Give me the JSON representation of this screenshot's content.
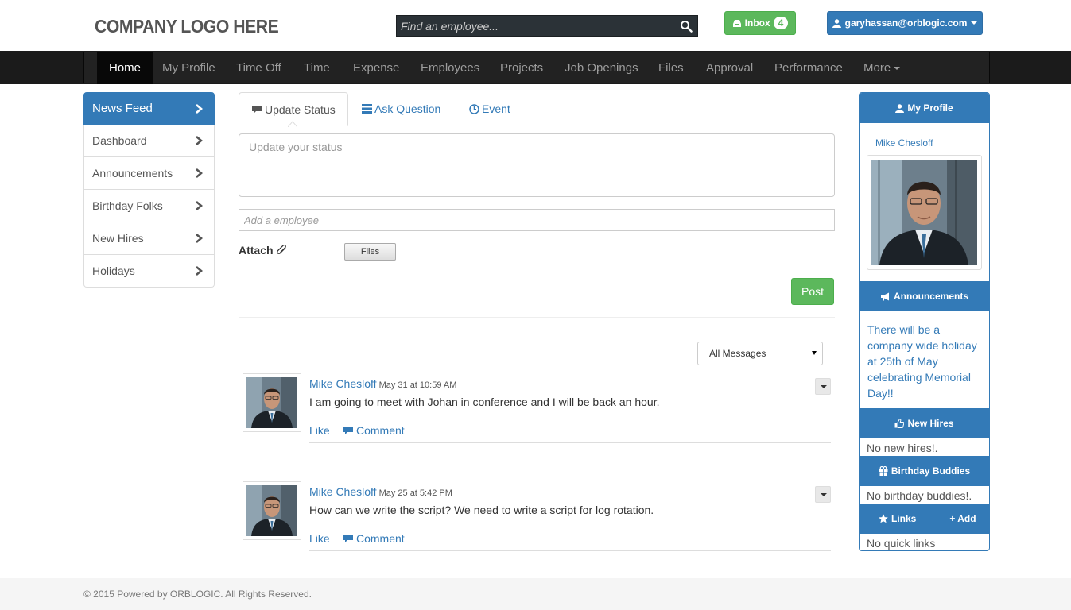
{
  "header": {
    "logo_text": "COMPANY LOGO HERE",
    "search_placeholder": "Find an employee...",
    "inbox_label": "Inbox",
    "inbox_count": "4",
    "user_email": "garyhassan@orblogic.com"
  },
  "nav": {
    "items": [
      "Home",
      "My Profile",
      "Time Off",
      "Time",
      "Expense",
      "Employees",
      "Projects",
      "Job Openings",
      "Files",
      "Approval",
      "Performance",
      "More"
    ],
    "active": "Home"
  },
  "sidebar": {
    "items": [
      "News Feed",
      "Dashboard",
      "Announcements",
      "Birthday Folks",
      "New Hires",
      "Holidays"
    ]
  },
  "composer": {
    "tabs": [
      "Update Status",
      "Ask Question",
      "Event"
    ],
    "status_placeholder": "Update your status",
    "employee_placeholder": "Add a employee",
    "attach_label": "Attach",
    "files_button": "Files",
    "post_button": "Post"
  },
  "feed": {
    "filter_value": "All Messages",
    "posts": [
      {
        "author": "Mike Chesloff",
        "date": "May 31 at 10:59 AM",
        "text": "I am going to meet with Johan in conference and I will be back an hour.",
        "like": "Like",
        "comment": "Comment"
      },
      {
        "author": "Mike Chesloff",
        "date": "May 25 at 5:42 PM",
        "text": "How can we write the script? We need to write a script for log rotation.",
        "like": "Like",
        "comment": "Comment"
      }
    ]
  },
  "right": {
    "profile_title": "My Profile",
    "profile_name": "Mike Chesloff",
    "announcements_title": "Announcements",
    "announcement_text": "There will be a company wide holiday at 25th of May celebrating Memorial Day!!",
    "newhires_title": "New Hires",
    "newhires_text": "No new hires!.",
    "birthday_title": "Birthday Buddies",
    "birthday_text": "No birthday buddies!.",
    "links_title": "Links",
    "links_add": "+ Add",
    "links_text": "No quick links"
  },
  "footer": {
    "text": "© 2015 Powered by ORBLOGIC. All Rights Reserved."
  },
  "colors": {
    "primary": "#337ab7",
    "success": "#5cb85c",
    "navbar": "#222222"
  }
}
